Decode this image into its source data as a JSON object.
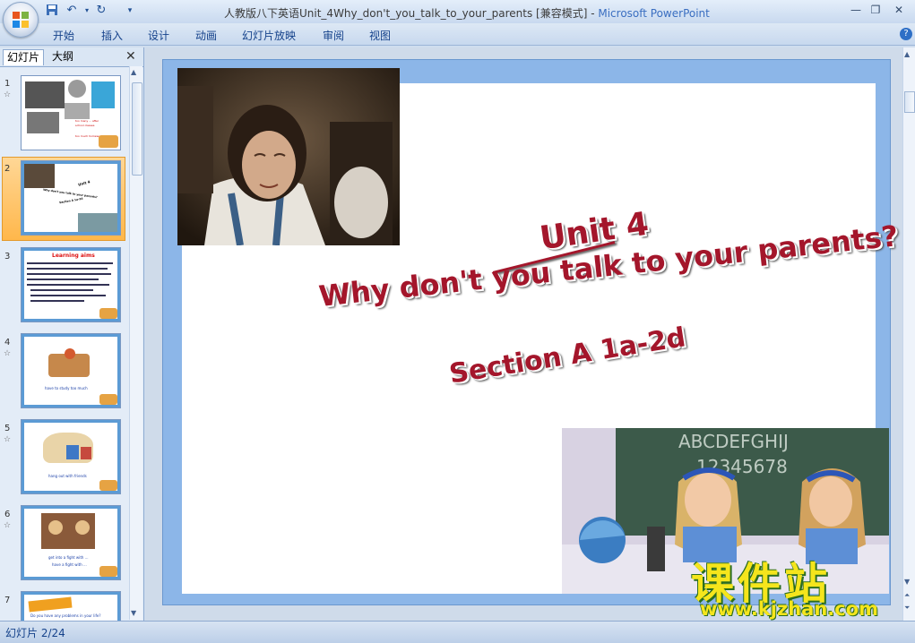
{
  "window": {
    "title_doc": "人教版八下英语Unit_4Why_don't_you_talk_to_your_parents [兼容模式]",
    "title_sep": " - ",
    "title_app": "Microsoft PowerPoint"
  },
  "ribbon": {
    "tabs": [
      "开始",
      "插入",
      "设计",
      "动画",
      "幻灯片放映",
      "审阅",
      "视图"
    ]
  },
  "left_pane": {
    "tabs": [
      "幻灯片",
      "大纲"
    ],
    "close_glyph": "✕",
    "selected_slide": 2,
    "thumbnails": [
      {
        "num": "1",
        "lines": [
          "too many ... after",
          "school classes",
          "too much homework"
        ]
      },
      {
        "num": "2",
        "lines": [
          "Unit 4",
          "Why don't you talk to your parents?",
          "Section A 1a-2d"
        ]
      },
      {
        "num": "3",
        "lines": [
          "Learning aims"
        ]
      },
      {
        "num": "4",
        "lines": [
          "have to study too much"
        ]
      },
      {
        "num": "5",
        "lines": [
          "hang out with friends"
        ]
      },
      {
        "num": "6",
        "lines": [
          "get into a fight with ...",
          "have a fight with ..."
        ]
      },
      {
        "num": "7",
        "lines": [
          "Do you have any problems in your life?"
        ]
      }
    ]
  },
  "slide": {
    "unit": "Unit 4",
    "title": "Why don't you talk to your parents?",
    "section": "Section A 1a-2d"
  },
  "watermark": {
    "cn": "课件站",
    "url": "www.kjzhan.com"
  },
  "status": {
    "slide_indicator": "幻灯片 2/24"
  },
  "colors": {
    "wordart": "#a4162b",
    "selected_thumb": "#ffb74b",
    "ribbon": "#c7d8ee"
  }
}
